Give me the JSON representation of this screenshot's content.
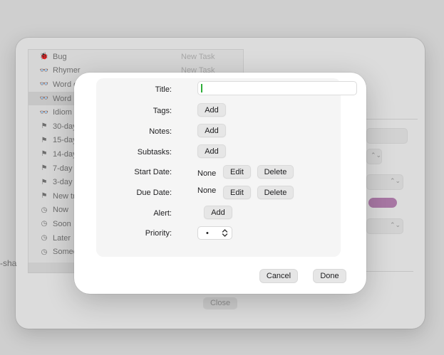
{
  "background": {
    "list_items": [
      {
        "icon": "ladybug-icon",
        "glyph": "🐞",
        "label": "Bug",
        "sub": "New Task"
      },
      {
        "icon": "glasses-icon",
        "glyph": "👓",
        "label": "Rhymer",
        "sub": "New Task"
      },
      {
        "icon": "glasses-icon",
        "glyph": "👓",
        "label": "Word o",
        "sub": ""
      },
      {
        "icon": "glasses-icon",
        "glyph": "👓",
        "label": "Word",
        "sub": ""
      },
      {
        "icon": "glasses-icon",
        "glyph": "👓",
        "label": "Idiom",
        "sub": ""
      },
      {
        "icon": "flag-icon",
        "glyph": "⚑",
        "label": "30-day t",
        "sub": ""
      },
      {
        "icon": "flag-icon",
        "glyph": "⚑",
        "label": "15-day t",
        "sub": ""
      },
      {
        "icon": "flag-icon",
        "glyph": "⚑",
        "label": "14-day t",
        "sub": ""
      },
      {
        "icon": "flag-icon",
        "glyph": "⚑",
        "label": "7-day tr",
        "sub": ""
      },
      {
        "icon": "flag-icon",
        "glyph": "⚑",
        "label": "3-day tr",
        "sub": ""
      },
      {
        "icon": "flag-icon",
        "glyph": "⚑",
        "label": "New tria",
        "sub": ""
      },
      {
        "icon": "clock-icon",
        "glyph": "◷",
        "label": "Now",
        "sub": ""
      },
      {
        "icon": "clock-icon",
        "glyph": "◷",
        "label": "Soon",
        "sub": ""
      },
      {
        "icon": "clock-icon",
        "glyph": "◷",
        "label": "Later",
        "sub": ""
      },
      {
        "icon": "clock-icon",
        "glyph": "◷",
        "label": "Someda",
        "sub": ""
      }
    ],
    "selected_index": 3,
    "side_text": "-sha",
    "close_label": "Close",
    "accent_color": "#a877a4"
  },
  "modal": {
    "title_label": "Title:",
    "title_value": "",
    "tags_label": "Tags:",
    "tags_button": "Add",
    "notes_label": "Notes:",
    "notes_button": "Add",
    "subtasks_label": "Subtasks:",
    "subtasks_button": "Add",
    "start_date_label": "Start Date:",
    "start_date_value": "None",
    "start_edit_button": "Edit",
    "start_delete_button": "Delete",
    "due_date_label": "Due Date:",
    "due_date_value": "None",
    "due_edit_button": "Edit",
    "due_delete_button": "Delete",
    "alert_label": "Alert:",
    "alert_button": "Add",
    "priority_label": "Priority:",
    "priority_value": "•",
    "cancel_button": "Cancel",
    "done_button": "Done"
  }
}
